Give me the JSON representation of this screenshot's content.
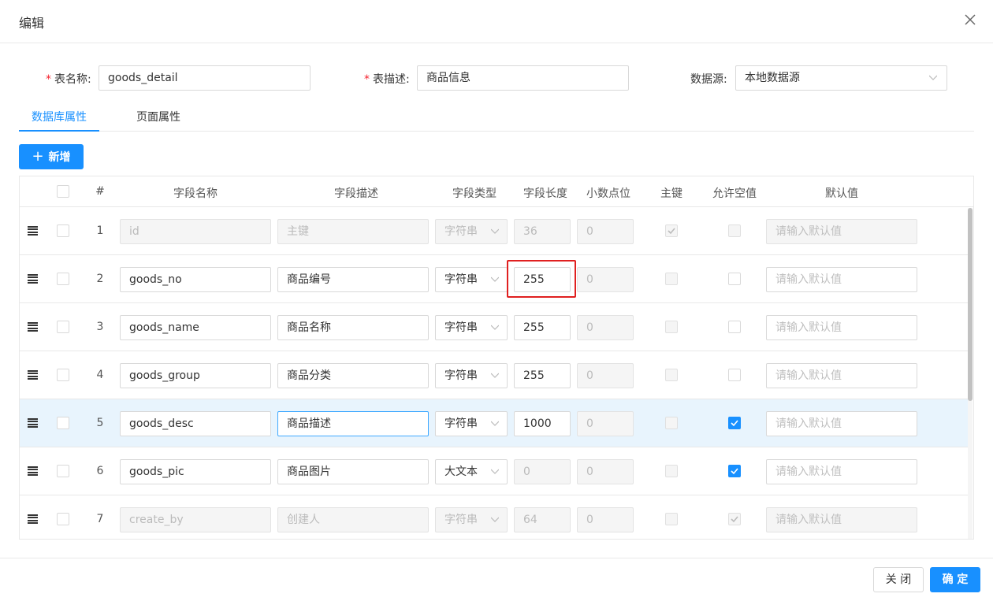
{
  "dialog": {
    "title": "编辑"
  },
  "form": {
    "table_name_label": "表名称",
    "table_name_value": "goods_detail",
    "table_desc_label": "表描述",
    "table_desc_value": "商品信息",
    "datasource_label": "数据源",
    "datasource_value": "本地数据源",
    "required_mark": "*",
    "colon": ":"
  },
  "tabs": [
    {
      "label": "数据库属性",
      "active": true
    },
    {
      "label": "页面属性",
      "active": false
    }
  ],
  "toolbar": {
    "add_label": "新增",
    "add_icon": "+"
  },
  "columns": {
    "index": "#",
    "name": "字段名称",
    "desc": "字段描述",
    "type": "字段类型",
    "length": "字段长度",
    "decimal": "小数点位",
    "pk": "主键",
    "nullable": "允许空值",
    "default": "默认值"
  },
  "default_placeholder": "请输入默认值",
  "rows": [
    {
      "index": "1",
      "name": "id",
      "desc": "主键",
      "type": "字符串",
      "length": "36",
      "decimal": "0",
      "pk": true,
      "nullable": false,
      "locked": true,
      "length_disabled": true
    },
    {
      "index": "2",
      "name": "goods_no",
      "desc": "商品编号",
      "type": "字符串",
      "length": "255",
      "decimal": "0",
      "pk": false,
      "nullable": false,
      "locked": false,
      "length_disabled": false
    },
    {
      "index": "3",
      "name": "goods_name",
      "desc": "商品名称",
      "type": "字符串",
      "length": "255",
      "decimal": "0",
      "pk": false,
      "nullable": false,
      "locked": false,
      "length_disabled": false
    },
    {
      "index": "4",
      "name": "goods_group",
      "desc": "商品分类",
      "type": "字符串",
      "length": "255",
      "decimal": "0",
      "pk": false,
      "nullable": false,
      "locked": false,
      "length_disabled": false
    },
    {
      "index": "5",
      "name": "goods_desc",
      "desc": "商品描述",
      "type": "字符串",
      "length": "1000",
      "decimal": "0",
      "pk": false,
      "nullable": true,
      "locked": false,
      "length_disabled": false
    },
    {
      "index": "6",
      "name": "goods_pic",
      "desc": "商品图片",
      "type": "大文本",
      "length": "0",
      "decimal": "0",
      "pk": false,
      "nullable": true,
      "locked": false,
      "length_disabled": true
    },
    {
      "index": "7",
      "name": "create_by",
      "desc": "创建人",
      "type": "字符串",
      "length": "64",
      "decimal": "0",
      "pk": false,
      "nullable": true,
      "locked": true,
      "length_disabled": true
    }
  ],
  "footer": {
    "close_label": "关 闭",
    "ok_label": "确 定"
  },
  "colors": {
    "primary": "#1890ff",
    "highlight_row": "#e8f4fd",
    "annotation": "#e02020"
  }
}
